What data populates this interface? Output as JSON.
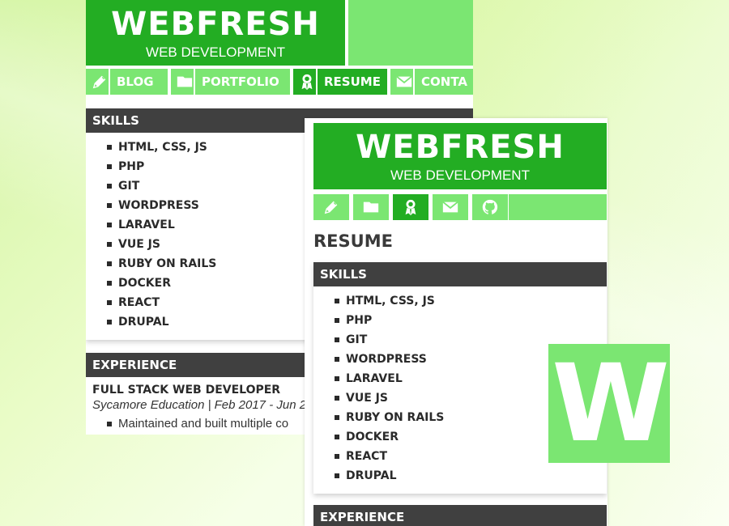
{
  "brand": {
    "name": "WEBFRESH",
    "tagline": "WEB DEVELOPMENT"
  },
  "colors": {
    "primary_green": "#23ad23",
    "light_green": "#7be672",
    "section_header": "#404040"
  },
  "nav": {
    "items": [
      {
        "label": "BLOG",
        "icon": "pen-icon"
      },
      {
        "label": "PORTFOLIO",
        "icon": "folder-icon"
      },
      {
        "label": "RESUME",
        "icon": "award-icon",
        "active": true
      },
      {
        "label": "CONTA",
        "icon": "envelope-icon"
      },
      {
        "label": "",
        "icon": "github-icon"
      }
    ]
  },
  "page": {
    "title": "RESUME"
  },
  "skills": {
    "heading": "SKILLS",
    "items": [
      "HTML, CSS, JS",
      "PHP",
      "GIT",
      "WORDPRESS",
      "LARAVEL",
      "VUE JS",
      "RUBY ON RAILS",
      "DOCKER",
      "REACT",
      "DRUPAL"
    ]
  },
  "experience": {
    "heading": "EXPERIENCE",
    "job_title": "FULL STACK WEB DEVELOPER",
    "job_meta": "Sycamore Education | Feb 2017 - Jun 2",
    "bullet": "Maintained and built multiple co"
  },
  "logo": {
    "letter": "W"
  }
}
